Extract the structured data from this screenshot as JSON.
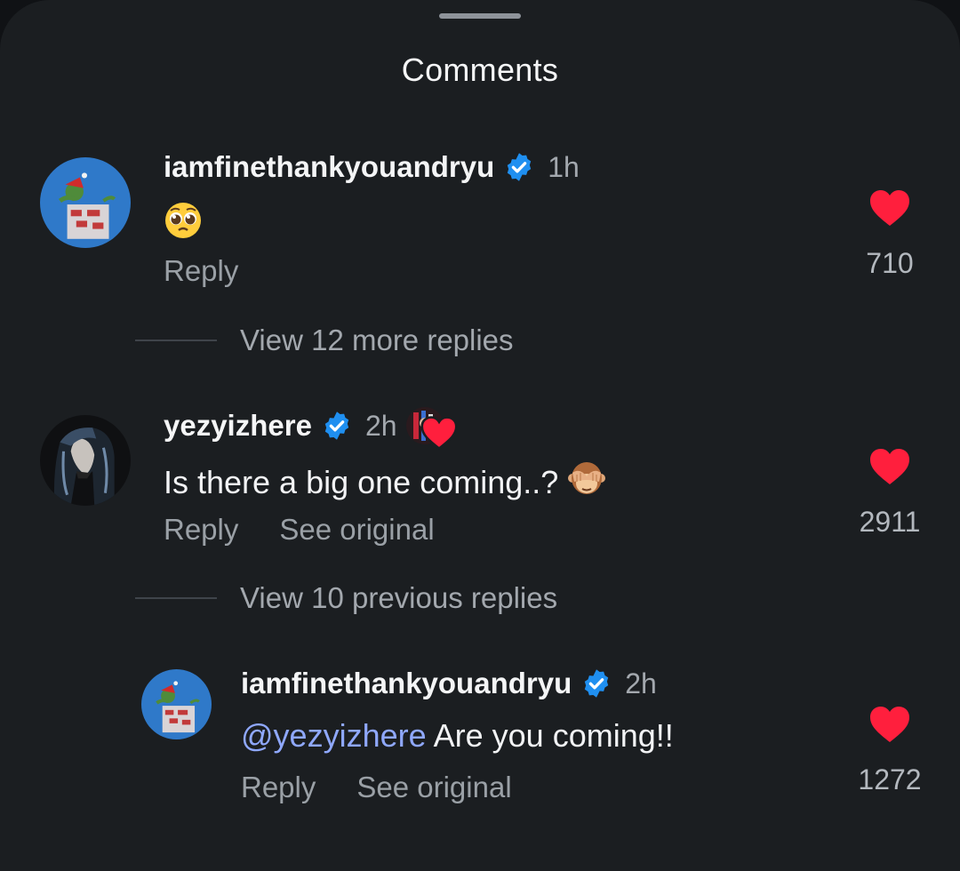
{
  "sheet": {
    "title": "Comments"
  },
  "comments": [
    {
      "username": "iamfinethankyouandryu",
      "time": "1h",
      "text_emoji": "pleading-face",
      "reply_label": "Reply",
      "likes": "710",
      "view_replies": "View 12 more replies"
    },
    {
      "username": "yezyizhere",
      "time": "2h",
      "text": "Is there a big one coming..?",
      "text_emoji": "see-no-evil-monkey",
      "reply_label": "Reply",
      "see_original_label": "See original",
      "likes": "2911",
      "view_replies": "View 10 previous replies"
    }
  ],
  "reply": {
    "username": "iamfinethankyouandryu",
    "time": "2h",
    "mention": "@yezyizhere",
    "text": " Are you coming!!",
    "reply_label": "Reply",
    "see_original_label": "See original",
    "likes": "1272"
  },
  "colors": {
    "background": "#1b1e21",
    "like_heart": "#ff1f3d",
    "verified_badge": "#1f8ff0",
    "mention": "#8fa8ff",
    "muted_text": "#9aa0a6"
  }
}
